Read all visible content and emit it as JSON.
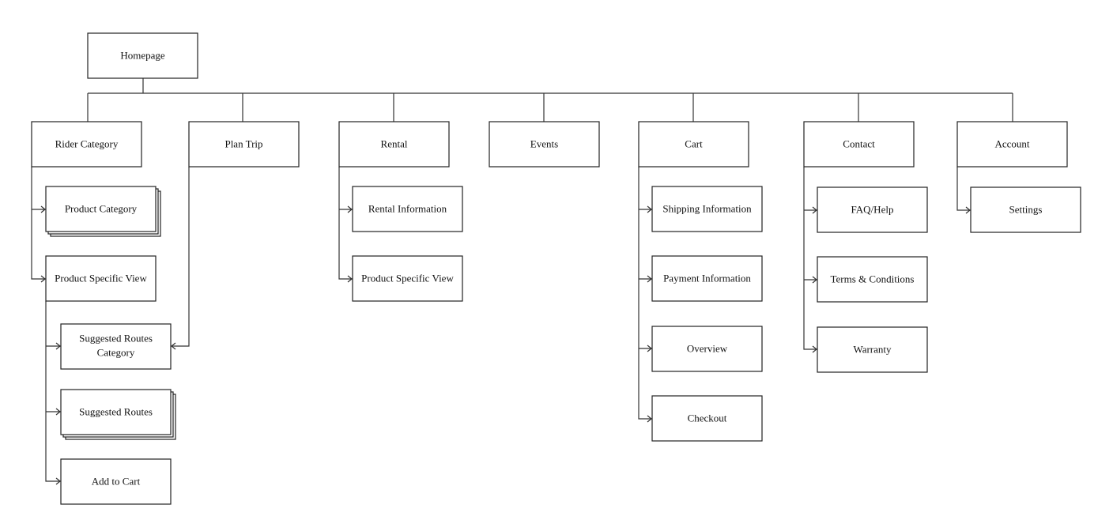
{
  "diagram": {
    "root": "Homepage",
    "sections": [
      {
        "label": "Rider Category",
        "children": [
          {
            "label": "Product Category",
            "stacked": true
          },
          {
            "label": "Product Specific View",
            "children": [
              {
                "label": "Suggested Routes Category",
                "lines": [
                  "Suggested Routes",
                  "Category"
                ]
              },
              {
                "label": "Suggested Routes",
                "stacked": true
              },
              {
                "label": "Add to Cart"
              }
            ]
          }
        ]
      },
      {
        "label": "Plan Trip",
        "links_to": "Suggested Routes Category"
      },
      {
        "label": "Rental",
        "children": [
          {
            "label": "Rental Information"
          },
          {
            "label": "Product Specific View"
          }
        ]
      },
      {
        "label": "Events"
      },
      {
        "label": "Cart",
        "children": [
          {
            "label": "Shipping Information"
          },
          {
            "label": "Payment Information"
          },
          {
            "label": "Overview"
          },
          {
            "label": "Checkout"
          }
        ]
      },
      {
        "label": "Contact",
        "children": [
          {
            "label": "FAQ/Help"
          },
          {
            "label": "Terms & Conditions"
          },
          {
            "label": "Warranty"
          }
        ]
      },
      {
        "label": "Account",
        "children": [
          {
            "label": "Settings"
          }
        ]
      }
    ]
  }
}
